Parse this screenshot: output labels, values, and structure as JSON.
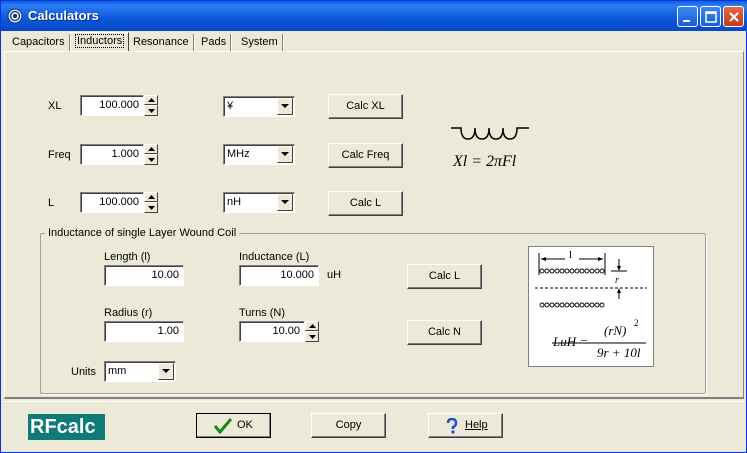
{
  "window": {
    "title": "Calculators"
  },
  "tabs": [
    {
      "label": "Capacitors"
    },
    {
      "label": "Inductors",
      "active": true
    },
    {
      "label": "Resonance"
    },
    {
      "label": "Pads"
    },
    {
      "label": "System"
    }
  ],
  "calc": {
    "xl": {
      "label": "XL",
      "value": "100.000",
      "unit": "¥",
      "button": "Calc XL"
    },
    "freq": {
      "label": "Freq",
      "value": "1.000",
      "unit": "MHz",
      "button": "Calc Freq"
    },
    "l": {
      "label": "L",
      "value": "100.000",
      "unit": "nH",
      "button": "Calc L"
    },
    "formula": "Xl = 2πFl"
  },
  "coil": {
    "group_title": "Inductance of single Layer Wound Coil",
    "length_label": "Length (l)",
    "length_value": "10.00",
    "inductance_label": "Inductance (L)",
    "inductance_value": "10.000",
    "inductance_unit": "uH",
    "calc_l_button": "Calc L",
    "radius_label": "Radius (r)",
    "radius_value": "1.00",
    "turns_label": "Turns (N)",
    "turns_value": "10.00",
    "calc_n_button": "Calc N",
    "units_label": "Units",
    "units_value": "mm",
    "diagram_l": "l",
    "diagram_r": "r",
    "formula_lhs": "LuH =",
    "formula_num": "(rN)",
    "formula_exp": "2",
    "formula_den": "9r + 10l"
  },
  "footer": {
    "logo": "RFcalc",
    "ok": "OK",
    "copy": "Copy",
    "help": "Help"
  }
}
